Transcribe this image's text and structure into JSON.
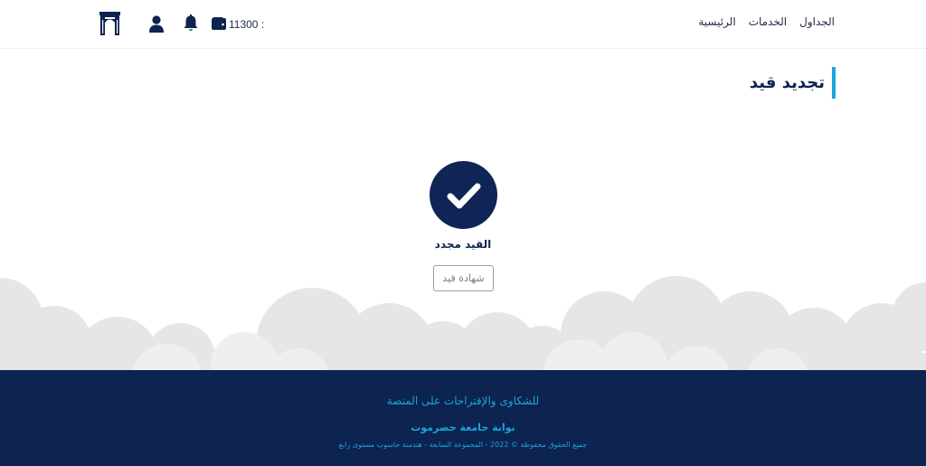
{
  "header": {
    "nav": [
      {
        "label": "الرئيسية"
      },
      {
        "label": "الخدمات"
      },
      {
        "label": "الجداول"
      }
    ],
    "balance_prefix": ": ",
    "balance_value": "11300",
    "icons": [
      "university-logo-icon",
      "user-icon",
      "bell-icon",
      "wallet-icon"
    ]
  },
  "main": {
    "page_title": "تجديد قيد",
    "status_icon": "check-icon",
    "status_text": "القيد مجدد",
    "certificate_button": "شهادة قيد"
  },
  "footer": {
    "complaints_link": "للشكاوى والإقتراحات على المنصة",
    "brand": "بوابة جامعة حضرموت",
    "copyright": "جميع الحقوق محفوظة © 2022 - المجموعة السابعة - هندسة حاسوب مستوى رابع"
  },
  "colors": {
    "primary": "#0d2350",
    "accent": "#1aa6d9",
    "cloud": "#e6e6e6"
  }
}
